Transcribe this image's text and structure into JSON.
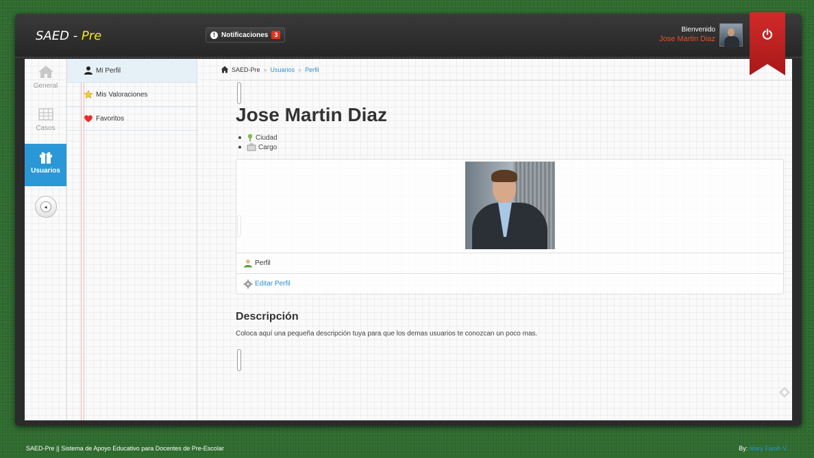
{
  "app": {
    "brand": "SAED - ",
    "brand_accent": "Pre"
  },
  "header": {
    "notifications_label": "Notificaciones",
    "notifications_count": "3",
    "welcome_label": "Bienvenido",
    "user_name": "Jose Martin Diaz"
  },
  "iconbar": {
    "items": [
      {
        "label": "General",
        "icon": "home-icon"
      },
      {
        "label": "Casos",
        "icon": "grid-icon"
      },
      {
        "label": "Usuarios",
        "icon": "gift-icon"
      }
    ],
    "active": "Usuarios"
  },
  "submenu": {
    "items": [
      {
        "label": "Mi Perfil",
        "icon": "user-icon"
      },
      {
        "label": "Mis Valoraciones",
        "icon": "star-icon"
      },
      {
        "label": "Favoritos",
        "icon": "heart-icon"
      }
    ]
  },
  "breadcrumb": {
    "root": "SAED-Pre",
    "items": [
      "Usuarios",
      "Perfil"
    ],
    "separator": "»"
  },
  "profile": {
    "name": "Jose Martin Diaz",
    "city_label": "Ciudad",
    "job_label": "Cargo",
    "profile_label": "Perfil",
    "edit_label": "Editar Perfil",
    "description_title": "Descripción",
    "description_text": "Coloca aquí una pequeña descripción tuya para que los demas usuarios te conozcan un poco mas."
  },
  "footer": {
    "left_text": "SAED-Pre || Sistema de Apoyo Educativo para Docentes de Pre-Escolar",
    "by_label": "By: ",
    "author": "Mary Farah V."
  },
  "colors": {
    "accent_blue": "#2a97d6",
    "ribbon_red": "#c82222",
    "notif_red": "#e0321d",
    "user_name_orange": "#e2542c",
    "brand_yellow": "#f2e51a"
  }
}
